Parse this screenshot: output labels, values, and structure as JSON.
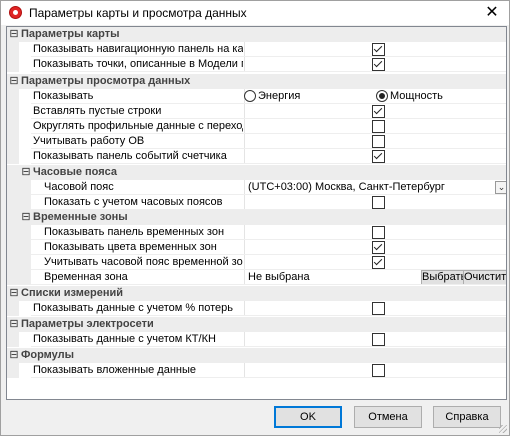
{
  "window": {
    "title": "Параметры карты и просмотра данных",
    "close": "✕"
  },
  "categories": {
    "map": "Параметры карты",
    "view": "Параметры просмотра данных",
    "timezones": "Часовые пояса",
    "timeZones": "Временные зоны",
    "lists": "Списки измерений",
    "elec": "Параметры электросети",
    "formulas": "Формулы"
  },
  "props": {
    "showNavPanel": {
      "label": "Показывать навигационную панель на карте",
      "checked": true
    },
    "showPoints": {
      "label": "Показывать точки, описанные в Модели по умолч",
      "checked": true
    },
    "show": {
      "label": "Показывать",
      "option1": "Энергия",
      "option2": "Мощность",
      "selected": "Мощность"
    },
    "insertEmpty": {
      "label": "Вставлять пустые строки",
      "checked": true
    },
    "roundProfile": {
      "label": "Округлять профильные данные с переходящим ос",
      "checked": false
    },
    "considerOV": {
      "label": "Учитывать работу ОВ",
      "checked": false
    },
    "showMeterEvents": {
      "label": "Показывать панель событий счетчика",
      "checked": true
    },
    "timeZone": {
      "label": "Часовой пояс",
      "value": "(UTC+03:00) Москва, Санкт-Петербург",
      "arrow": "⌄"
    },
    "showWithTz": {
      "label": "Показать с учетом часовых поясов",
      "checked": false
    },
    "showTzPanel": {
      "label": "Показывать панель временных зон",
      "checked": false
    },
    "showTzColors": {
      "label": "Показывать цвета временных зон",
      "checked": true
    },
    "considerTzBelt": {
      "label": "Учитывать часовой пояс временной зоны",
      "checked": true
    },
    "timeZoneSel": {
      "label": "Временная зона",
      "value": "Не выбрана",
      "select": "Выбрать",
      "clear": "Очистить"
    },
    "showLosses": {
      "label": "Показывать данные с учетом % потерь",
      "checked": false
    },
    "showKtKn": {
      "label": "Показывать данные с учетом КТ/КН",
      "checked": false
    },
    "showNested": {
      "label": "Показывать вложенные данные",
      "checked": false
    }
  },
  "buttons": {
    "ok": "OK",
    "cancel": "Отмена",
    "help": "Справка"
  }
}
